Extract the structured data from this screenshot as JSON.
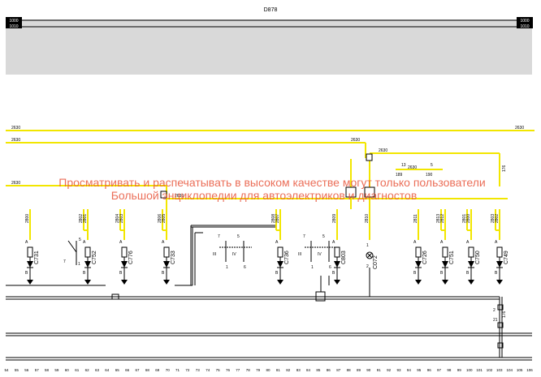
{
  "sheet": {
    "component_code": "D878",
    "left_codes": [
      "1000",
      "1010"
    ],
    "right_codes": [
      "1000",
      "1010"
    ]
  },
  "watermark": {
    "line1": "Просматривать и распечатывать в высоком качестве могут только пользователи",
    "line2": "Большой энциклопедии для автоэлектриков и диагностов"
  },
  "wire_labels": {
    "main": "2630",
    "w2800": "2800",
    "w2801": "2801",
    "w2802": "2802",
    "w2803": "2803",
    "w2804": "2804",
    "w2805": "2805",
    "w2806": "2806",
    "w2807": "2807",
    "w2808": "2808",
    "w2809": "2809",
    "w2810": "2810",
    "w2811": "2811",
    "w2812": "2812",
    "w2813": "2813"
  },
  "connectors": [
    {
      "code": "C731"
    },
    {
      "code": "C752"
    },
    {
      "code": "C776"
    },
    {
      "code": "C733"
    },
    {
      "code": "C736"
    },
    {
      "code": "C803"
    },
    {
      "code": "C072"
    },
    {
      "code": "C726"
    },
    {
      "code": "C751"
    },
    {
      "code": "C750"
    },
    {
      "code": "C749"
    }
  ],
  "terminals": {
    "pin_a": "A",
    "pin_b": "B",
    "pin_1": "1",
    "pin_2": "2",
    "pin_5": "5",
    "pin_6": "6",
    "pin_7": "7",
    "pin_21": "21",
    "roman_iii": "III",
    "roman_iv": "IV"
  },
  "references": {
    "ref_189": "189",
    "ref_190": "190",
    "ref_13": "13",
    "ref_5": "5",
    "ref_176": "176"
  },
  "colors": {
    "wire_yellow": "#f2e600",
    "wire_dark": "#000000",
    "header_bar": "#d9d9d9",
    "watermark": "#e8553b"
  },
  "grid_ruler": [
    "54",
    "55",
    "56",
    "57",
    "58",
    "59",
    "60",
    "61",
    "62",
    "63",
    "64",
    "65",
    "66",
    "67",
    "68",
    "69",
    "70",
    "71",
    "72",
    "73",
    "74",
    "75",
    "76",
    "77",
    "78",
    "79",
    "80",
    "81",
    "82",
    "83",
    "84",
    "85",
    "86",
    "87",
    "88",
    "89",
    "90",
    "91",
    "92",
    "93",
    "94",
    "95",
    "96",
    "97",
    "98",
    "99",
    "100",
    "101",
    "102",
    "103",
    "104",
    "105",
    "106"
  ]
}
